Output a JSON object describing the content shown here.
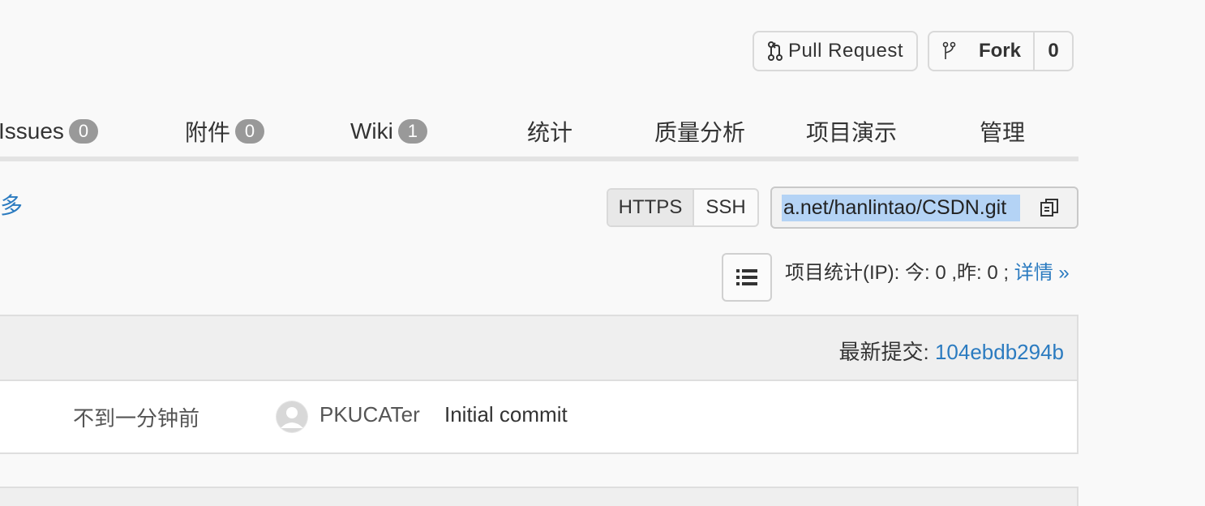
{
  "header": {
    "pull_request_label": "Pull Request",
    "fork_label": "Fork",
    "fork_count": "0"
  },
  "tabs": [
    {
      "label": "Issues",
      "badge": "0"
    },
    {
      "label": "附件",
      "badge": "0"
    },
    {
      "label": "Wiki",
      "badge": "1"
    },
    {
      "label": "统计"
    },
    {
      "label": "质量分析"
    },
    {
      "label": "项目演示"
    },
    {
      "label": "管理"
    }
  ],
  "more_link": "更多",
  "clone": {
    "https_label": "HTTPS",
    "ssh_label": "SSH",
    "url": "a.net/hanlintao/CSDN.git"
  },
  "stats": {
    "text": "项目统计(IP): 今: 0 ,昨: 0 ; ",
    "detail_link": "详情 »"
  },
  "commit": {
    "latest_label": "最新提交: ",
    "latest_hash": "104ebdb294b",
    "time": "不到一分钟前",
    "author": "PKUCATer",
    "message": "Initial commit"
  },
  "colors": {
    "link": "#2b7bc0",
    "badge": "#999999",
    "selection": "#b4d3f5"
  }
}
